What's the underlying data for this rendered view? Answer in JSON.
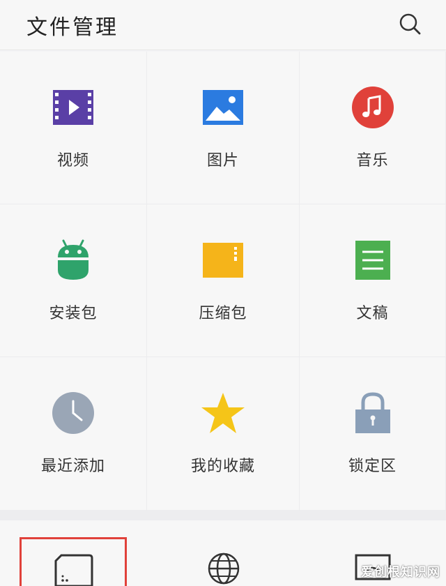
{
  "header": {
    "title": "文件管理",
    "search_icon": "search-icon"
  },
  "categories": [
    {
      "label": "视频",
      "icon": "video-icon",
      "color": "#5a3fa6"
    },
    {
      "label": "图片",
      "icon": "image-icon",
      "color": "#2b7be0"
    },
    {
      "label": "音乐",
      "icon": "music-icon",
      "color": "#e0413a"
    },
    {
      "label": "安装包",
      "icon": "android-icon",
      "color": "#2fa36b"
    },
    {
      "label": "压缩包",
      "icon": "archive-icon",
      "color": "#f5b41a"
    },
    {
      "label": "文稿",
      "icon": "document-icon",
      "color": "#4caf50"
    },
    {
      "label": "最近添加",
      "icon": "clock-icon",
      "color": "#9aa6b6"
    },
    {
      "label": "我的收藏",
      "icon": "star-icon",
      "color": "#f5c518"
    },
    {
      "label": "锁定区",
      "icon": "lock-icon",
      "color": "#8a9fb8"
    }
  ],
  "storage": {
    "items": [
      {
        "icon": "sd-card-icon"
      },
      {
        "icon": "globe-icon"
      },
      {
        "icon": "monitor-icon"
      }
    ],
    "highlight_color": "#e0413a"
  },
  "watermark": "爱创根知识网"
}
